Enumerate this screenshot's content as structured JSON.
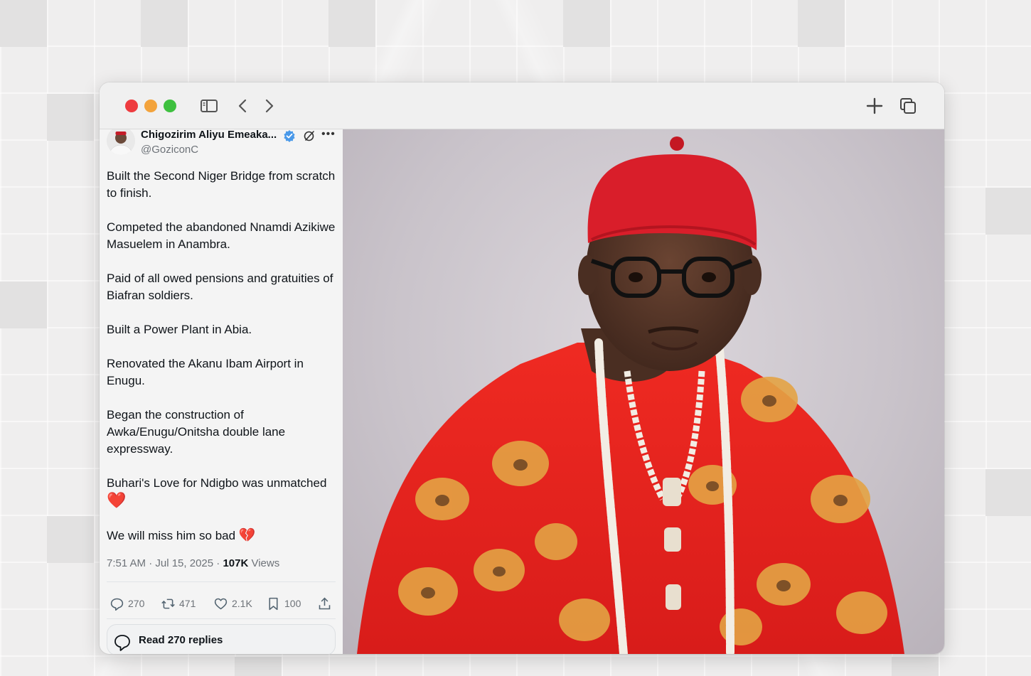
{
  "window": {
    "controls": {
      "close": "close",
      "minimize": "minimize",
      "zoom": "zoom"
    },
    "toolbar_icons": [
      "sidebar-icon",
      "back-icon",
      "forward-icon",
      "new-tab-icon",
      "tabs-overview-icon"
    ]
  },
  "tweet": {
    "author_name": "Chigozirim Aliyu Emeaka...",
    "handle": "@GoziconC",
    "paragraphs": [
      "Built the Second Niger Bridge from scratch to finish.",
      "Competed the abandoned Nnamdi Azikiwe Masuelem in Anambra.",
      "Paid of all owed pensions and gratuities of Biafran soldiers.",
      "Built a Power Plant in Abia.",
      "Renovated the Akanu Ibam Airport in Enugu.",
      "Began the construction of Awka/Enugu/Onitsha double lane expressway.",
      "Buhari's Love for Ndigbo was unmatched",
      "We will miss him so bad"
    ],
    "heart_emoji": "❤️",
    "broken_heart_emoji": "💔",
    "timestamp": "7:51 AM · Jul 15, 2025 · ",
    "views_count": "107K",
    "views_label": " Views",
    "actions": {
      "replies": "270",
      "reposts": "471",
      "likes": "2.1K",
      "bookmarks": "100"
    },
    "read_replies_label": "Read 270 replies"
  },
  "colors": {
    "traffic_red": "#ee3b3f",
    "traffic_yellow": "#f3a33c",
    "traffic_green": "#3ec03f",
    "verified_blue": "#4a99e9",
    "robe_red": "#e8231e",
    "cap_red": "#d91e2a"
  }
}
